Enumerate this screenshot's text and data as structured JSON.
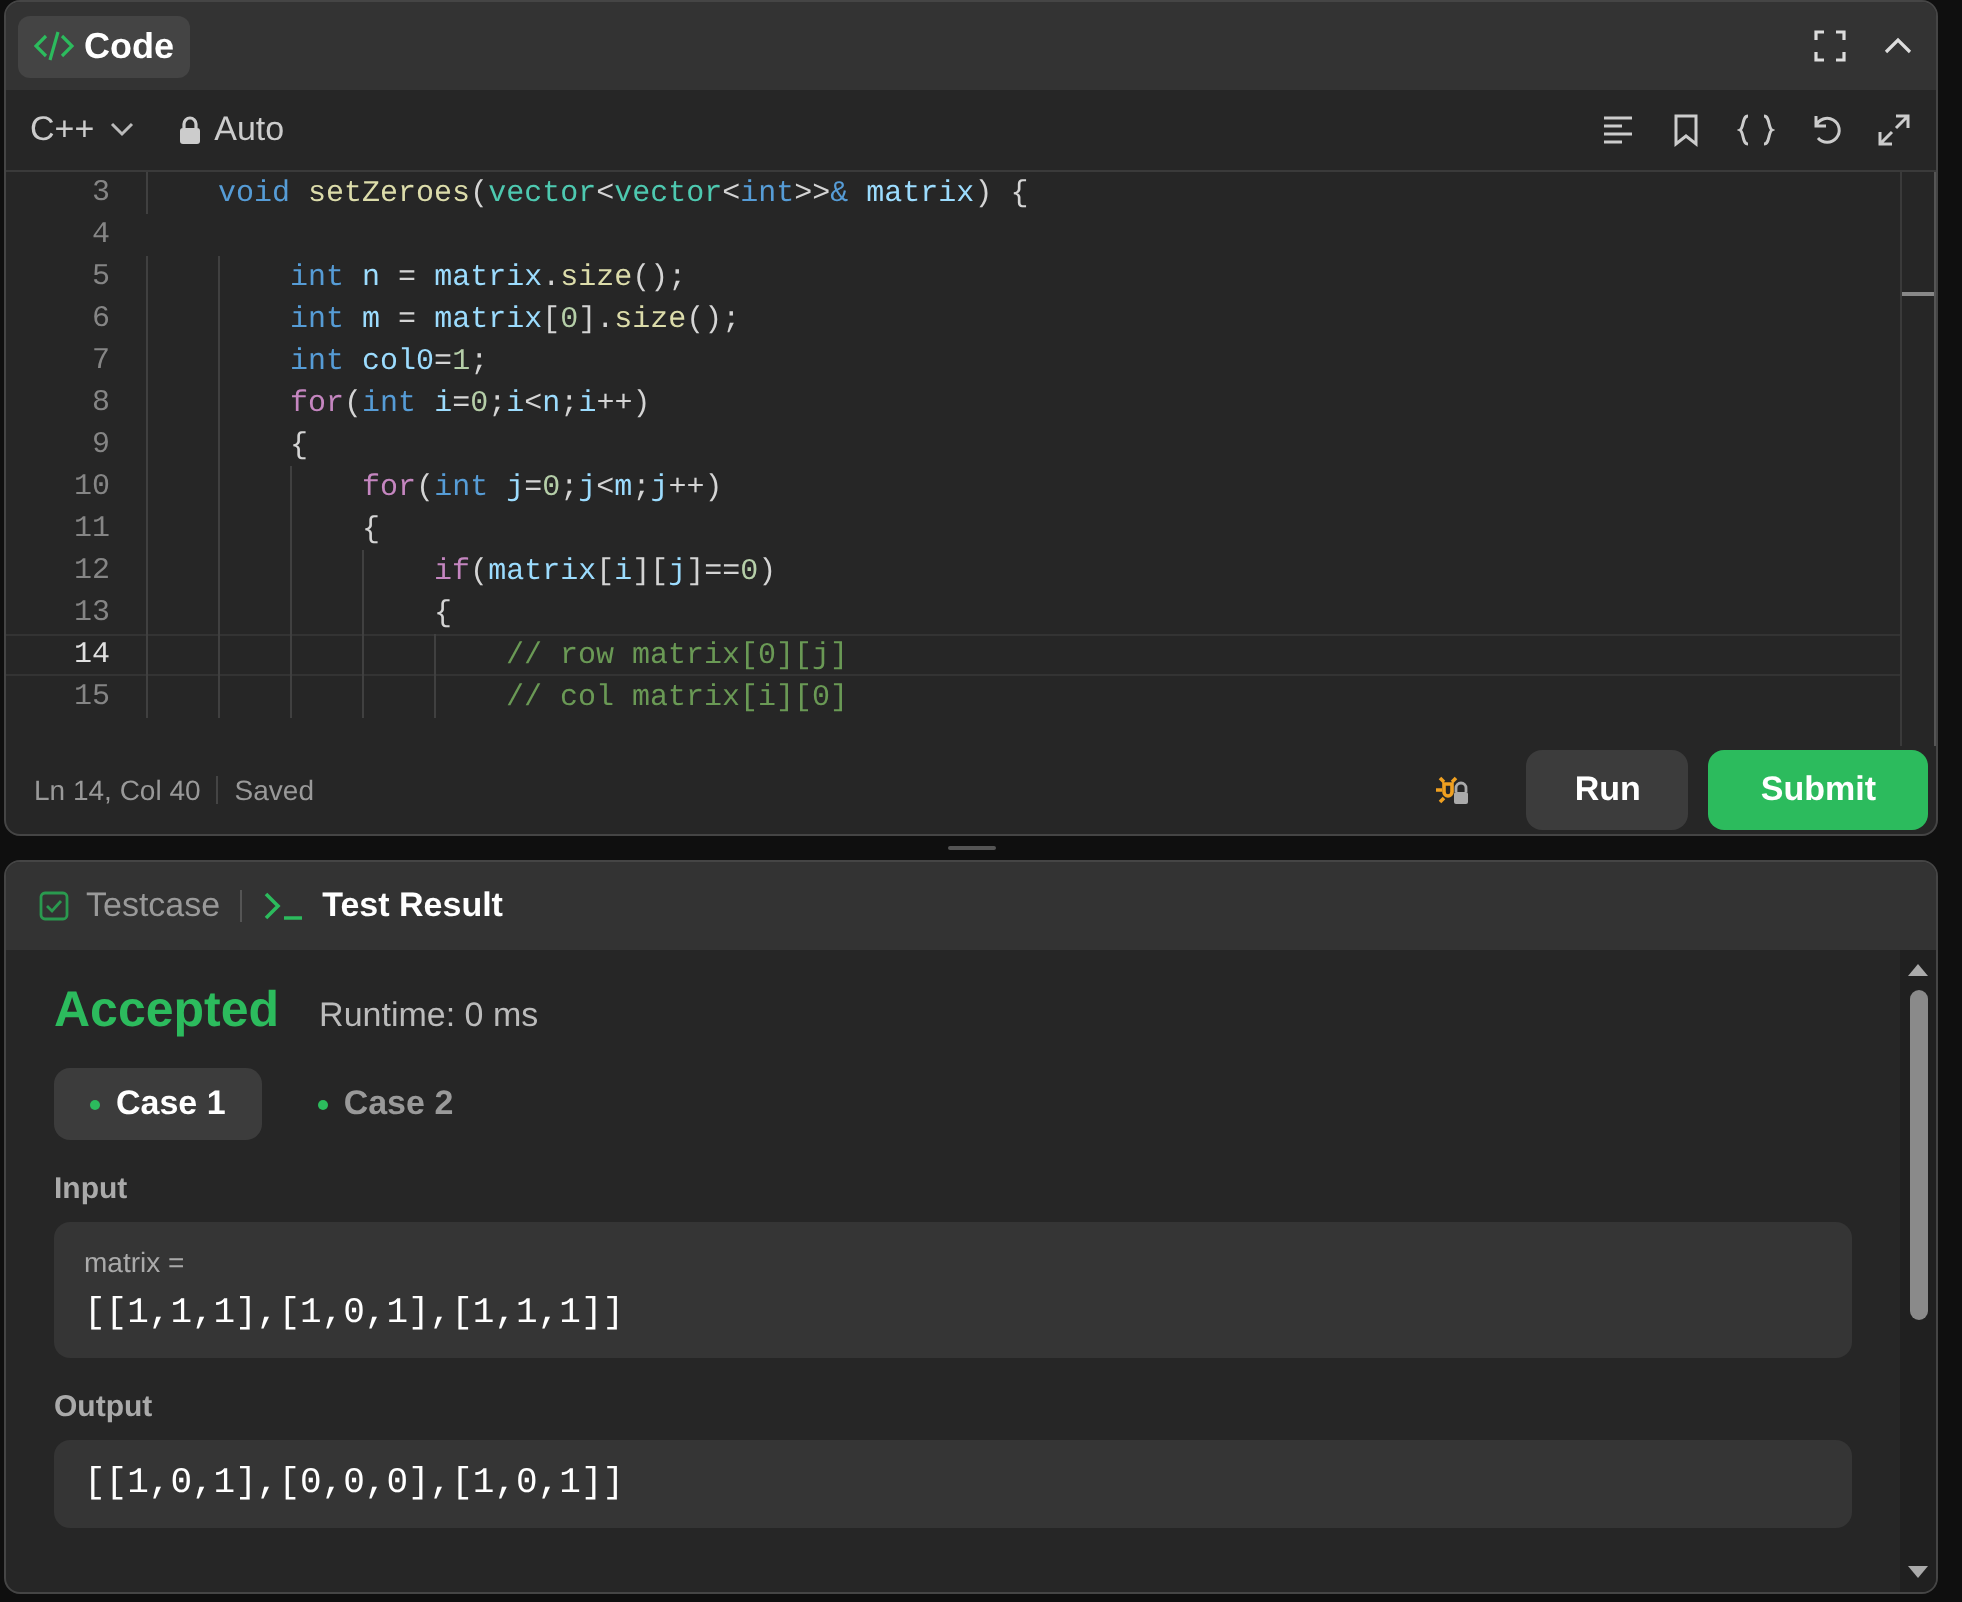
{
  "editor": {
    "tab": "Code",
    "language": "C++",
    "mode": "Auto",
    "lines": [
      {
        "number": "3",
        "current": false,
        "tokens": [
          {
            "kind": "kw",
            "text": "    void"
          },
          {
            "kind": "fn",
            "text": " setZeroes"
          },
          {
            "kind": "p",
            "text": "("
          },
          {
            "kind": "type",
            "text": "vector"
          },
          {
            "kind": "p",
            "text": "<"
          },
          {
            "kind": "type",
            "text": "vector"
          },
          {
            "kind": "p",
            "text": "<"
          },
          {
            "kind": "kw",
            "text": "int"
          },
          {
            "kind": "p",
            "text": ">>"
          },
          {
            "kind": "kw",
            "text": "&"
          },
          {
            "kind": "var",
            "text": " matrix"
          },
          {
            "kind": "p",
            "text": ") {"
          }
        ]
      },
      {
        "number": "4",
        "current": false
      },
      {
        "number": "5",
        "current": false,
        "tokens": [
          {
            "kind": "kw",
            "text": "        int"
          },
          {
            "kind": "var",
            "text": " n"
          },
          {
            "kind": "p",
            "text": " = "
          },
          {
            "kind": "var",
            "text": "matrix"
          },
          {
            "kind": "p",
            "text": "."
          },
          {
            "kind": "fn",
            "text": "size"
          },
          {
            "kind": "p",
            "text": "();"
          }
        ]
      },
      {
        "number": "6",
        "current": false,
        "tokens": [
          {
            "kind": "kw",
            "text": "        int"
          },
          {
            "kind": "var",
            "text": " m"
          },
          {
            "kind": "p",
            "text": " = "
          },
          {
            "kind": "var",
            "text": "matrix"
          },
          {
            "kind": "p",
            "text": "["
          },
          {
            "kind": "num",
            "text": "0"
          },
          {
            "kind": "p",
            "text": "]."
          },
          {
            "kind": "fn",
            "text": "size"
          },
          {
            "kind": "p",
            "text": "();"
          }
        ]
      },
      {
        "number": "7",
        "current": false,
        "tokens": [
          {
            "kind": "kw",
            "text": "        int"
          },
          {
            "kind": "var",
            "text": " col0"
          },
          {
            "kind": "p",
            "text": "="
          },
          {
            "kind": "num",
            "text": "1"
          },
          {
            "kind": "p",
            "text": ";"
          }
        ]
      },
      {
        "number": "8",
        "current": false,
        "tokens": [
          {
            "kind": "ctrl",
            "text": "        for"
          },
          {
            "kind": "p",
            "text": "("
          },
          {
            "kind": "kw",
            "text": "int"
          },
          {
            "kind": "var",
            "text": " i"
          },
          {
            "kind": "p",
            "text": "="
          },
          {
            "kind": "num",
            "text": "0"
          },
          {
            "kind": "p",
            "text": ";"
          },
          {
            "kind": "var",
            "text": "i"
          },
          {
            "kind": "p",
            "text": "<"
          },
          {
            "kind": "var",
            "text": "n"
          },
          {
            "kind": "p",
            "text": ";"
          },
          {
            "kind": "var",
            "text": "i"
          },
          {
            "kind": "p",
            "text": "++)"
          }
        ]
      },
      {
        "number": "9",
        "current": false,
        "tokens": [
          {
            "kind": "p",
            "text": "        {"
          }
        ]
      },
      {
        "number": "10",
        "current": false,
        "tokens": [
          {
            "kind": "ctrl",
            "text": "            for"
          },
          {
            "kind": "p",
            "text": "("
          },
          {
            "kind": "kw",
            "text": "int"
          },
          {
            "kind": "var",
            "text": " j"
          },
          {
            "kind": "p",
            "text": "="
          },
          {
            "kind": "num",
            "text": "0"
          },
          {
            "kind": "p",
            "text": ";"
          },
          {
            "kind": "var",
            "text": "j"
          },
          {
            "kind": "p",
            "text": "<"
          },
          {
            "kind": "var",
            "text": "m"
          },
          {
            "kind": "p",
            "text": ";"
          },
          {
            "kind": "var",
            "text": "j"
          },
          {
            "kind": "p",
            "text": "++)"
          }
        ]
      },
      {
        "number": "11",
        "current": false,
        "tokens": [
          {
            "kind": "p",
            "text": "            {"
          }
        ]
      },
      {
        "number": "12",
        "current": false,
        "tokens": [
          {
            "kind": "ctrl",
            "text": "                if"
          },
          {
            "kind": "p",
            "text": "("
          },
          {
            "kind": "var",
            "text": "matrix"
          },
          {
            "kind": "p",
            "text": "["
          },
          {
            "kind": "var",
            "text": "i"
          },
          {
            "kind": "p",
            "text": "]["
          },
          {
            "kind": "var",
            "text": "j"
          },
          {
            "kind": "p",
            "text": "]=="
          },
          {
            "kind": "num",
            "text": "0"
          },
          {
            "kind": "p",
            "text": ")"
          }
        ]
      },
      {
        "number": "13",
        "current": false,
        "tokens": [
          {
            "kind": "p",
            "text": "                {"
          }
        ]
      },
      {
        "number": "14",
        "current": true,
        "tokens": [
          {
            "kind": "cm",
            "text": "                    // row matrix[0][j]"
          }
        ]
      },
      {
        "number": "15",
        "current": false,
        "tokens": [
          {
            "kind": "cm",
            "text": "                    // col matrix[i][0]"
          }
        ]
      }
    ],
    "position": "Ln 14, Col 40",
    "save_state": "Saved",
    "buttons": [
      {
        "label": "Run",
        "kind": "secondary"
      },
      {
        "label": "Submit",
        "kind": "primary"
      }
    ]
  },
  "results": {
    "tabs": [
      {
        "label": "Testcase",
        "selected": false
      },
      {
        "label": "Test Result",
        "selected": true
      }
    ],
    "verdict": "Accepted",
    "runtime": "Runtime: 0 ms",
    "cases": [
      {
        "label": "Case 1",
        "selected": true
      },
      {
        "label": "Case 2",
        "selected": false
      }
    ],
    "sections": [
      {
        "label": "Input",
        "variable": "matrix =",
        "value": "[[1,1,1],[1,0,1],[1,1,1]]"
      },
      {
        "label": "Output",
        "value": "[[1,0,1],[0,0,0],[1,0,1]]"
      }
    ]
  }
}
